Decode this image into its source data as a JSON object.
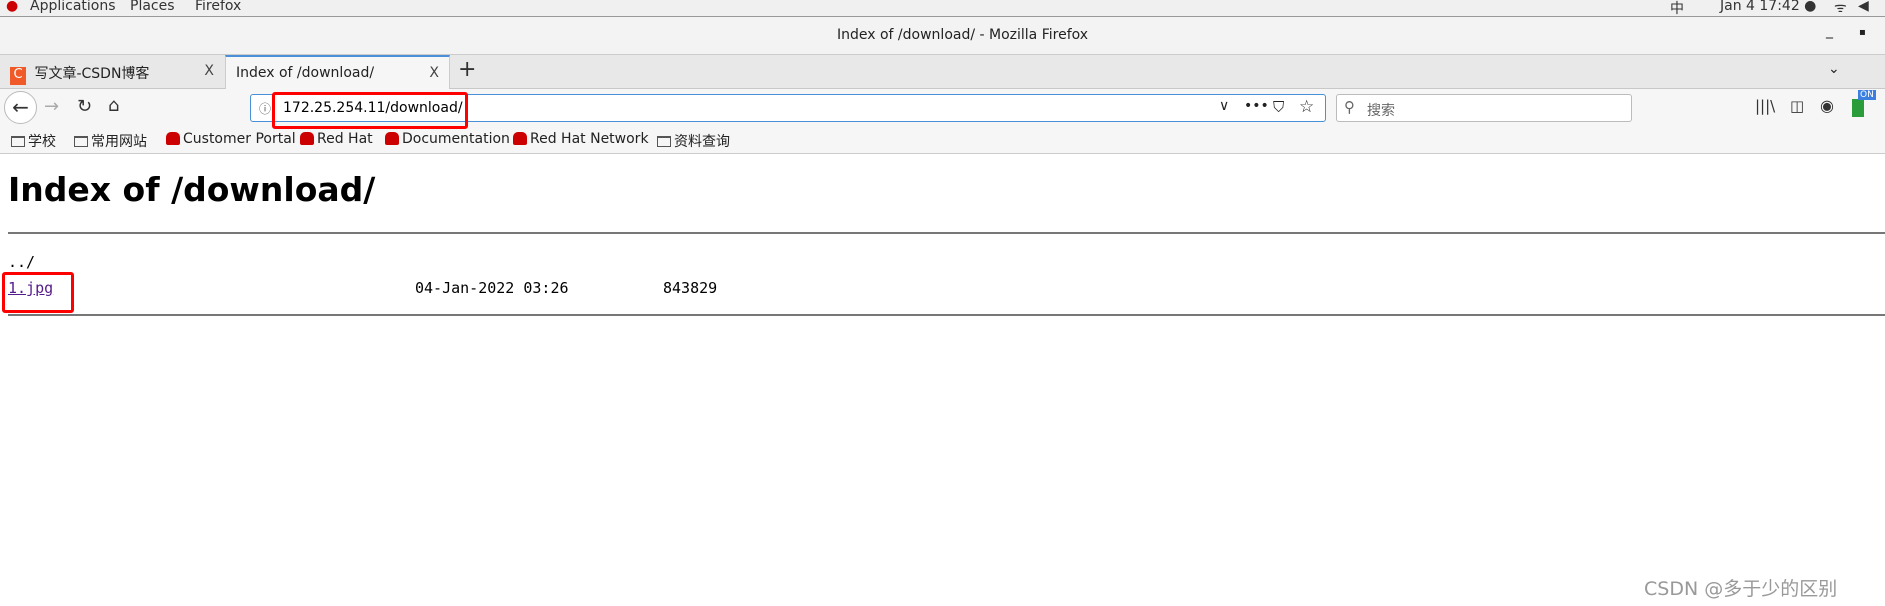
{
  "topbar": {
    "applications": "Applications",
    "places": "Places",
    "firefox": "Firefox",
    "input_method": "中",
    "clock": "Jan 4  17:42 ●"
  },
  "window": {
    "title": "Index of /download/ - Mozilla Firefox"
  },
  "tabs": [
    {
      "label": "写文章-CSDN博客",
      "favicon": "C"
    },
    {
      "label": "Index of /download/"
    }
  ],
  "nav": {
    "url": "172.25.254.11/download/",
    "search_placeholder": "搜索",
    "badge": "ON"
  },
  "bookmarks": [
    {
      "label": "学校",
      "icon": "folder"
    },
    {
      "label": "常用网站",
      "icon": "folder"
    },
    {
      "label": "Customer Portal",
      "icon": "redhat"
    },
    {
      "label": "Red Hat",
      "icon": "redhat"
    },
    {
      "label": "Documentation",
      "icon": "redhat"
    },
    {
      "label": "Red Hat Network",
      "icon": "redhat"
    },
    {
      "label": "资料查询",
      "icon": "folder"
    }
  ],
  "page": {
    "heading": "Index of /download/",
    "parent": "../",
    "files": [
      {
        "name": "1.jpg",
        "date": "04-Jan-2022 03:26",
        "size": "843829"
      }
    ]
  },
  "watermark": "CSDN @多于少的区别",
  "colors": {
    "highlight": "#ff0000",
    "link": "#0000ee",
    "visited": "#551a8b",
    "accent": "#4a90d9"
  }
}
